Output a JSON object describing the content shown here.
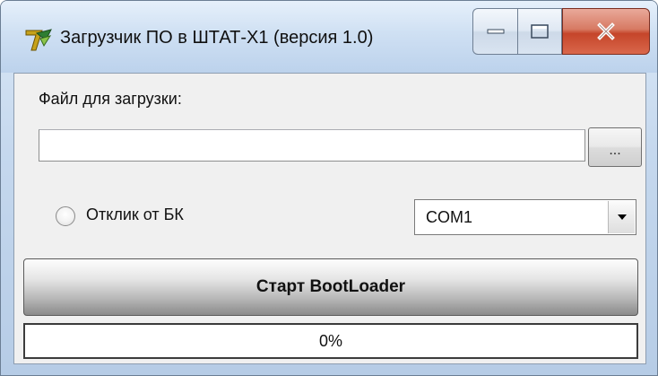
{
  "window": {
    "title": "Загрузчик ПО в ШТАТ-Х1 (версия 1.0)",
    "icon": "delphi-app-icon"
  },
  "file": {
    "label": "Файл для загрузки:",
    "value": "",
    "browse_label": "..."
  },
  "response": {
    "radio_label": "Отклик от БК",
    "selected": false
  },
  "port": {
    "selected": "COM1"
  },
  "start_button": {
    "label": "Старт BootLoader"
  },
  "progress": {
    "percent": 0,
    "text": "0%"
  }
}
